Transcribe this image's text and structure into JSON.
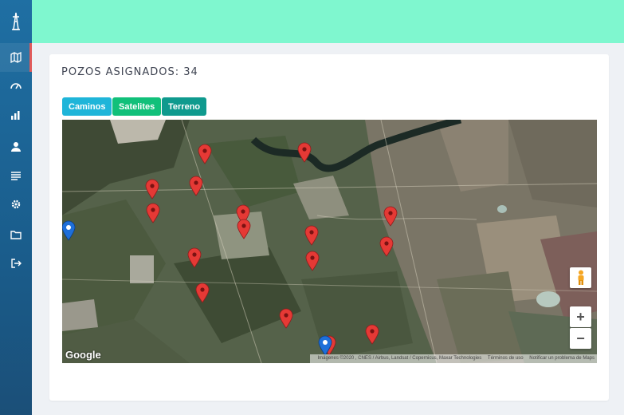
{
  "sidebar": {
    "items": [
      {
        "name": "map-icon",
        "active": true
      },
      {
        "name": "dashboard-icon",
        "active": false
      },
      {
        "name": "bar-chart-icon",
        "active": false
      },
      {
        "name": "user-icon",
        "active": false
      },
      {
        "name": "list-icon",
        "active": false
      },
      {
        "name": "gear-icon",
        "active": false
      },
      {
        "name": "folder-icon",
        "active": false
      },
      {
        "name": "logout-icon",
        "active": false
      }
    ]
  },
  "colors": {
    "topbar": "#7ff7cf",
    "btn_caminos": "#1fb5d9",
    "btn_satelites": "#11c07a",
    "btn_terreno": "#0f9a8e",
    "marker_red": "#e53935",
    "marker_blue": "#1e6fd9"
  },
  "card": {
    "title": "POZOS ASIGNADOS: 34",
    "buttons": {
      "caminos": "Caminos",
      "satelites": "Satelites",
      "terreno": "Terreno"
    }
  },
  "map": {
    "google_label": "Google",
    "attribution": "Imágenes ©2020 , CNES / Airbus, Landsat / Copernicus, Maxar Technologies",
    "terms": "Términos de uso",
    "report": "Notificar un problema de Maps",
    "zoom_in": "+",
    "zoom_out": "−"
  }
}
